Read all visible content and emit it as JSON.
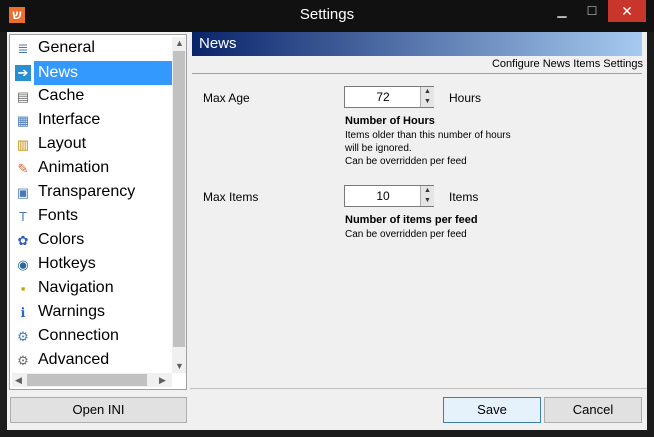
{
  "window": {
    "title": "Settings",
    "app_icon": "ש"
  },
  "nav": {
    "items": [
      {
        "label": "General",
        "icon": "general-icon",
        "glyph": "≣",
        "color": "#4a7ab5"
      },
      {
        "label": "News",
        "icon": "news-icon",
        "glyph": "➔",
        "color": "#ffffff",
        "bg": "#2a8fd0",
        "selected": true
      },
      {
        "label": "Cache",
        "icon": "cache-icon",
        "glyph": "▤",
        "color": "#6d6d6d"
      },
      {
        "label": "Interface",
        "icon": "interface-icon",
        "glyph": "▦",
        "color": "#4a7ab5"
      },
      {
        "label": "Layout",
        "icon": "layout-icon",
        "glyph": "▥",
        "color": "#c08a00"
      },
      {
        "label": "Animation",
        "icon": "animation-icon",
        "glyph": "✎",
        "color": "#e06030"
      },
      {
        "label": "Transparency",
        "icon": "transparency-icon",
        "glyph": "▣",
        "color": "#4a7ab5"
      },
      {
        "label": "Fonts",
        "icon": "fonts-icon",
        "glyph": "T",
        "color": "#4a7ab5"
      },
      {
        "label": "Colors",
        "icon": "colors-icon",
        "glyph": "✿",
        "color": "#2a5ac0"
      },
      {
        "label": "Hotkeys",
        "icon": "hotkeys-icon",
        "glyph": "◉",
        "color": "#2a6aa0"
      },
      {
        "label": "Navigation",
        "icon": "navigation-icon",
        "glyph": "▪",
        "color": "#d0a000"
      },
      {
        "label": "Warnings",
        "icon": "warnings-icon",
        "glyph": "ℹ",
        "color": "#2a6ac0"
      },
      {
        "label": "Connection",
        "icon": "connection-icon",
        "glyph": "⚙",
        "color": "#4a7ab5"
      },
      {
        "label": "Advanced",
        "icon": "advanced-icon",
        "glyph": "⚙",
        "color": "#6d6d6d"
      }
    ]
  },
  "buttons": {
    "open_ini": "Open INI",
    "save": "Save",
    "cancel": "Cancel"
  },
  "panel": {
    "title": "News",
    "subtitle": "Configure News Items Settings",
    "max_age": {
      "label": "Max Age",
      "value": "72",
      "unit": "Hours",
      "desc_title": "Number of Hours",
      "desc": [
        "Items older than this number of hours",
        "will be ignored.",
        "Can be overridden per feed"
      ]
    },
    "max_items": {
      "label": "Max Items",
      "value": "10",
      "unit": "Items",
      "desc_title": "Number of items per feed",
      "desc": [
        "Can be overridden per feed"
      ]
    }
  },
  "colors": {
    "header_gradient_start": "#0a246a",
    "header_gradient_end": "#a6caf0",
    "selection": "#3399ff",
    "close_button": "#c7352b"
  }
}
